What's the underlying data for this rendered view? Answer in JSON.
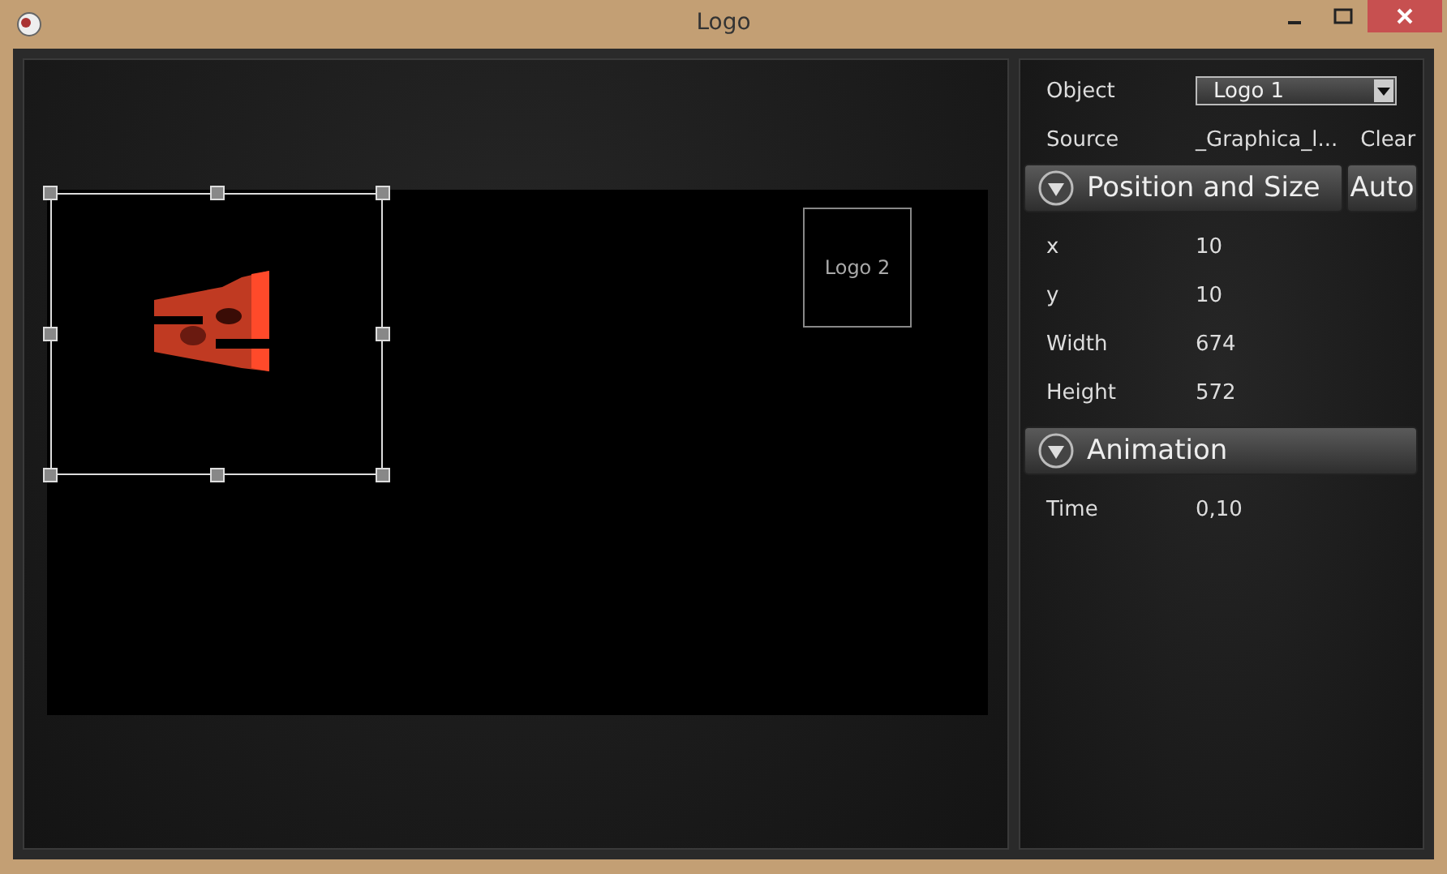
{
  "window": {
    "title": "Logo"
  },
  "canvas": {
    "items": [
      {
        "kind": "picture",
        "selected": true
      },
      {
        "kind": "label",
        "label": "Logo 2",
        "selected": false
      }
    ]
  },
  "properties": {
    "object": {
      "label": "Object",
      "value": "Logo 1"
    },
    "source": {
      "label": "Source",
      "value": "_Graphica_l...",
      "action": "Clear"
    },
    "sections": [
      {
        "title": "Position and Size",
        "expanded": true,
        "button": "Auto",
        "rows": [
          {
            "label": "x",
            "value": "10"
          },
          {
            "label": "y",
            "value": "10"
          },
          {
            "label": "Width",
            "value": "674"
          },
          {
            "label": "Height",
            "value": "572"
          }
        ]
      },
      {
        "title": "Animation",
        "expanded": true,
        "rows": [
          {
            "label": "Time",
            "value": "0,10"
          }
        ]
      }
    ]
  }
}
